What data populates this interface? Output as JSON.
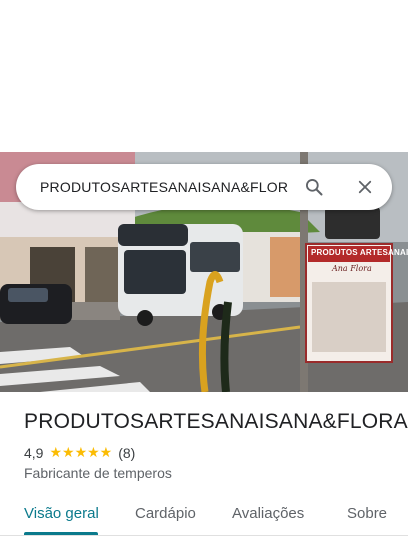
{
  "search": {
    "query": "PRODUTOSARTESANAISANA&FLOR"
  },
  "place": {
    "name": "PRODUTOSARTESANAISANA&FLORA",
    "rating": "4,9",
    "stars": "★★★★★",
    "review_count": "(8)",
    "category": "Fabricante de temperos"
  },
  "tabs": [
    {
      "label": "Visão geral",
      "active": true
    },
    {
      "label": "Cardápio"
    },
    {
      "label": "Avaliações"
    },
    {
      "label": "Sobre"
    }
  ],
  "photo": {
    "sign_title": "PRODUTOS ARTESANAIS",
    "sign_subtitle": "Ana Flora"
  },
  "colors": {
    "accent": "#0b7a8c",
    "star": "#fbbc04",
    "text": "#202124"
  }
}
